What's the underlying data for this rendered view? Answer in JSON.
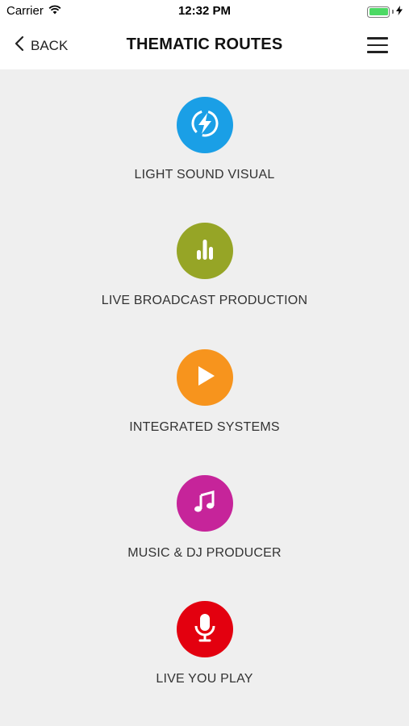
{
  "status_bar": {
    "carrier": "Carrier",
    "time": "12:32 PM"
  },
  "nav": {
    "back_label": "BACK",
    "title": "THEMATIC ROUTES"
  },
  "routes": [
    {
      "label": "LIGHT SOUND VISUAL",
      "icon": "lightning-icon",
      "color": "#1a9fe6"
    },
    {
      "label": "LIVE BROADCAST PRODUCTION",
      "icon": "bar-chart-icon",
      "color": "#96a526"
    },
    {
      "label": "INTEGRATED SYSTEMS",
      "icon": "play-icon",
      "color": "#f7941d"
    },
    {
      "label": "MUSIC & DJ PRODUCER",
      "icon": "music-note-icon",
      "color": "#c6249a"
    },
    {
      "label": "LIVE YOU PLAY",
      "icon": "microphone-icon",
      "color": "#e3000f"
    }
  ]
}
